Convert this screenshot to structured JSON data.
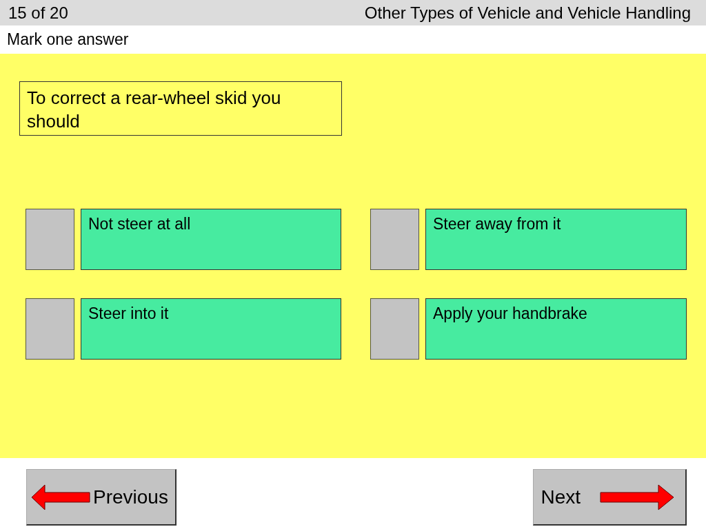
{
  "header": {
    "counter": "15 of 20",
    "topic": "Other Types of Vehicle and Vehicle Handling"
  },
  "instruction": "Mark one answer",
  "question": "To correct a rear-wheel skid you should",
  "answers": [
    {
      "text": "Not steer at all",
      "checked": false
    },
    {
      "text": "Steer away from it",
      "checked": false
    },
    {
      "text": "Steer into it",
      "checked": false
    },
    {
      "text": "Apply your handbrake",
      "checked": false
    }
  ],
  "buttons": {
    "previous": "Previous",
    "next": "Next"
  }
}
